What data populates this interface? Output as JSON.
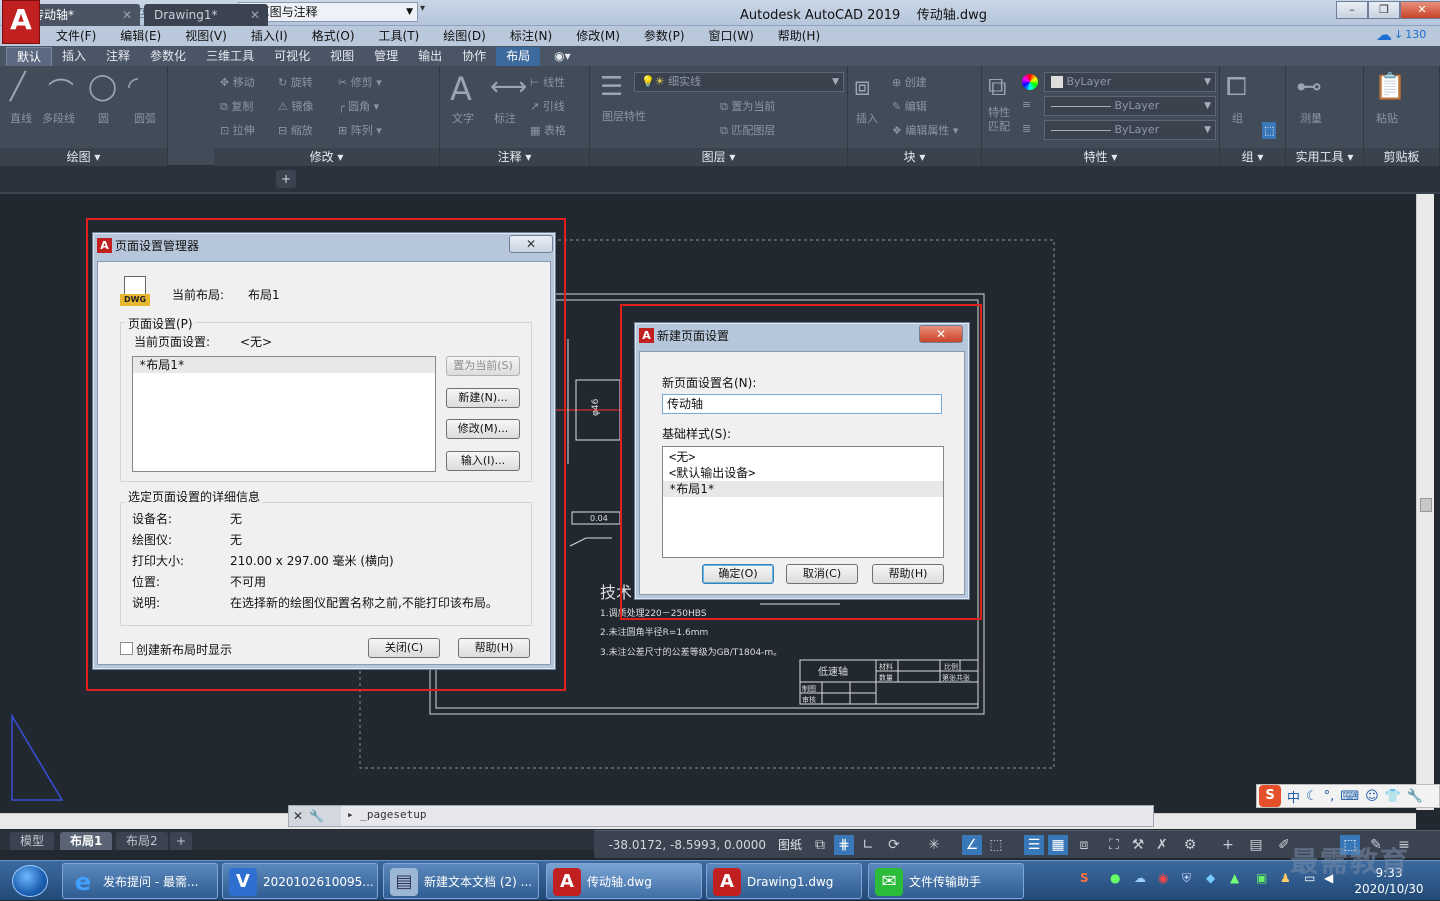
{
  "title_bar": {
    "app_title": "Autodesk AutoCAD 2019",
    "file_title": "传动轴.dwg",
    "workspace": "草图与注释",
    "logo": "A"
  },
  "menu": [
    "文件(F)",
    "编辑(E)",
    "视图(V)",
    "插入(I)",
    "格式(O)",
    "工具(T)",
    "绘图(D)",
    "标注(N)",
    "修改(M)",
    "参数(P)",
    "窗口(W)",
    "帮助(H)"
  ],
  "cloud_count": "130",
  "ribbon_tabs": [
    {
      "label": "默认",
      "state": "active"
    },
    {
      "label": "插入"
    },
    {
      "label": "注释"
    },
    {
      "label": "参数化"
    },
    {
      "label": "三维工具"
    },
    {
      "label": "可视化"
    },
    {
      "label": "视图"
    },
    {
      "label": "管理"
    },
    {
      "label": "输出"
    },
    {
      "label": "协作"
    },
    {
      "label": "布局",
      "state": "highlight"
    }
  ],
  "ribbon": {
    "draw": {
      "title": "绘图",
      "line": "直线",
      "polyline": "多段线",
      "circle": "圆",
      "arc": "圆弧"
    },
    "modify": {
      "title": "修改",
      "move": "移动",
      "rotate": "旋转",
      "trim": "修剪",
      "copy": "复制",
      "mirror": "镜像",
      "fillet": "圆角",
      "stretch": "拉伸",
      "scale": "缩放",
      "array": "阵列"
    },
    "annotation": {
      "title": "注释",
      "text": "文字",
      "dimension": "标注",
      "linear": "线性",
      "leader": "引线",
      "table": "表格"
    },
    "layers": {
      "title": "图层",
      "layer_props": "图层特性",
      "current_layer": "细实线",
      "make_current": "置为当前",
      "match_layer": "匹配图层"
    },
    "block": {
      "title": "块",
      "insert": "插入",
      "create": "创建",
      "edit": "编辑",
      "edit_attr": "编辑属性"
    },
    "properties": {
      "title": "特性",
      "match": "特性匹配",
      "color": "ByLayer",
      "linetype": "ByLayer",
      "lineweight": "ByLayer"
    },
    "groups": {
      "title": "组",
      "group": "组"
    },
    "utilities": {
      "title": "实用工具",
      "measure": "测量"
    },
    "clipboard": {
      "title": "剪贴板",
      "paste": "粘贴"
    }
  },
  "doc_tabs": [
    {
      "label": "传动轴*",
      "active": true
    },
    {
      "label": "Drawing1*"
    }
  ],
  "drawing": {
    "dim_text": "φ46",
    "tol_text": "0.04",
    "tech_title": "技术",
    "notes": [
      "1.调质处理220－250HBS",
      "2.未注圆角半径R=1.6mm",
      "3.未注公差尺寸的公差等级为GB/T1804-m。"
    ],
    "title_block_name": "低速轴",
    "tb_material": "材料",
    "tb_scale": "比例",
    "tb_qty": "数量",
    "tb_sheet": "第张共张",
    "tb_drawn": "制图",
    "tb_checked": "审核"
  },
  "command_line": {
    "text": "_pagesetup"
  },
  "layout_tabs": [
    {
      "label": "模型"
    },
    {
      "label": "布局1",
      "active": true
    },
    {
      "label": "布局2"
    }
  ],
  "status": {
    "coords": "-38.0172, -8.5993, 0.0000",
    "paper": "图纸"
  },
  "page_setup_manager": {
    "title": "页面设置管理器",
    "current_layout_label": "当前布局:",
    "current_layout_value": "布局1",
    "page_setups_group": "页面设置(P)",
    "current_setup_label": "当前页面设置:",
    "current_setup_value": "<无>",
    "list": [
      "*布局1*"
    ],
    "btn_set_current": "置为当前(S)",
    "btn_new": "新建(N)...",
    "btn_modify": "修改(M)...",
    "btn_import": "输入(I)...",
    "details_group": "选定页面设置的详细信息",
    "details": [
      {
        "label": "设备名:",
        "value": "无"
      },
      {
        "label": "绘图仪:",
        "value": "无"
      },
      {
        "label": "打印大小:",
        "value": "210.00 x 297.00 毫米 (横向)"
      },
      {
        "label": "位置:",
        "value": "不可用"
      },
      {
        "label": "说明:",
        "value": "在选择新的绘图仪配置名称之前,不能打印该布局。"
      }
    ],
    "show_on_new_layout": "创建新布局时显示",
    "btn_close": "关闭(C)",
    "btn_help": "帮助(H)",
    "dwg_label": "DWG"
  },
  "new_page_setup": {
    "title": "新建页面设置",
    "name_label": "新页面设置名(N):",
    "name_value": "传动轴",
    "base_label": "基础样式(S):",
    "base_list": [
      "<无>",
      "<默认输出设备>",
      "*布局1*"
    ],
    "btn_ok": "确定(O)",
    "btn_cancel": "取消(C)",
    "btn_help": "帮助(H)"
  },
  "ime": {
    "lang": "中"
  },
  "taskbar": [
    {
      "label": "发布提问 - 最需..."
    },
    {
      "label": "2020102610095..."
    },
    {
      "label": "新建文本文档 (2) ..."
    },
    {
      "label": "传动轴.dwg",
      "active": true
    },
    {
      "label": "Drawing1.dwg"
    },
    {
      "label": "文件传输助手"
    }
  ],
  "clock": {
    "time": "9:33",
    "date": "2020/10/30"
  },
  "watermark": "最需教育"
}
